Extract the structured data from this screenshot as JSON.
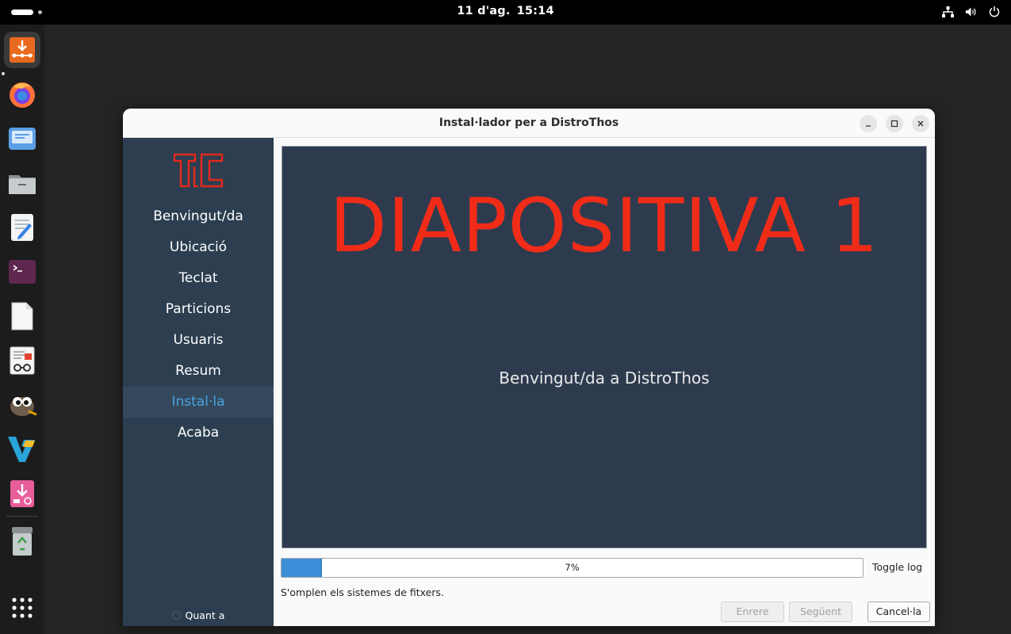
{
  "topbar": {
    "date": "11 d'ag.",
    "time": "15:14"
  },
  "dock": {
    "items": [
      {
        "name": "installer-icon",
        "active": true
      },
      {
        "name": "firefox-icon"
      },
      {
        "name": "mail-icon"
      },
      {
        "name": "files-icon"
      },
      {
        "name": "text-editor-icon"
      },
      {
        "name": "terminal-icon"
      },
      {
        "name": "document-icon"
      },
      {
        "name": "document-viewer-icon"
      },
      {
        "name": "gimp-icon"
      },
      {
        "name": "vscodium-icon"
      },
      {
        "name": "package-installer-icon"
      },
      {
        "name": "trash-icon"
      }
    ]
  },
  "window": {
    "title": "Instal·lador per a DistroThos"
  },
  "sidebar": {
    "steps": [
      {
        "label": "Benvingut/da"
      },
      {
        "label": "Ubicació"
      },
      {
        "label": "Teclat"
      },
      {
        "label": "Particions"
      },
      {
        "label": "Usuaris"
      },
      {
        "label": "Resum"
      },
      {
        "label": "Instal·la",
        "current": true
      },
      {
        "label": "Acaba"
      }
    ],
    "about_label": "Quant a"
  },
  "slide": {
    "title": "DIAPOSITIVA 1",
    "subtitle": "Benvingut/da a DistroThos"
  },
  "progress": {
    "value": 0.07,
    "label": "7%"
  },
  "toggle_log_label": "Toggle log",
  "status_text": "S'omplen els sistemes de fitxers.",
  "buttons": {
    "back": "Enrere",
    "next": "Següent",
    "cancel": "Cancel·la"
  },
  "colors": {
    "sidebar_bg": "#2c3e50",
    "current_step": "#4aa3e0",
    "slide_bg": "#2e3b4f",
    "slide_title": "#f02c18",
    "progress_fill": "#3b8fd8"
  }
}
